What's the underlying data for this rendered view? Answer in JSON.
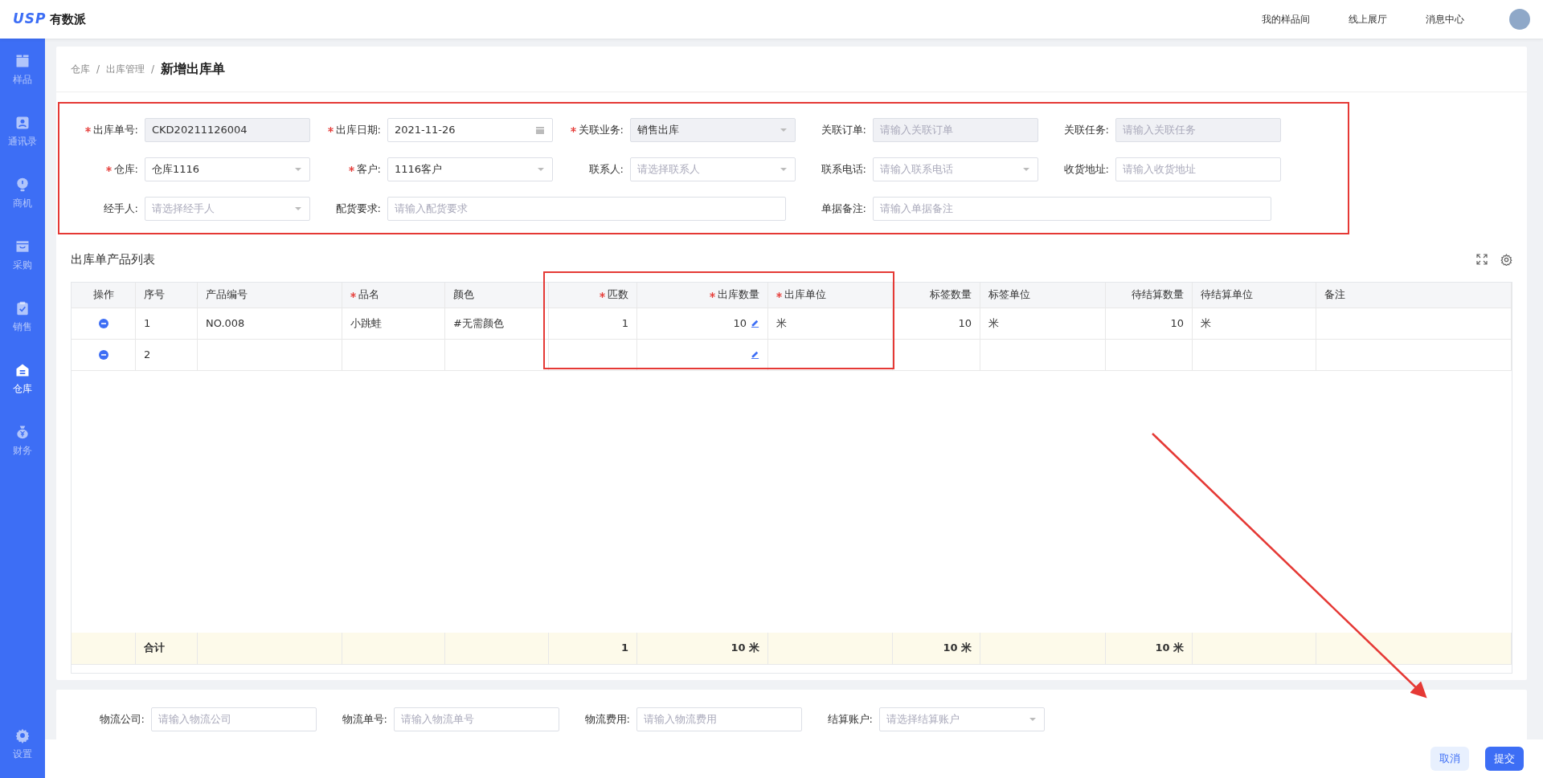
{
  "header": {
    "logo_mark": "USP",
    "logo_text": "有数派",
    "nav": [
      "我的样品间",
      "线上展厅",
      "消息中心"
    ]
  },
  "sidebar": {
    "items": [
      {
        "label": "样品",
        "selected": false
      },
      {
        "label": "通讯录",
        "selected": false
      },
      {
        "label": "商机",
        "selected": false
      },
      {
        "label": "采购",
        "selected": false
      },
      {
        "label": "销售",
        "selected": false
      },
      {
        "label": "仓库",
        "selected": true
      },
      {
        "label": "财务",
        "selected": false
      }
    ],
    "bottom_items": [
      {
        "label": "设置",
        "selected": false
      }
    ]
  },
  "breadcrumb": {
    "separator": "/",
    "items": [
      "仓库",
      "出库管理",
      "新增出库单"
    ]
  },
  "form": {
    "rows": [
      [
        {
          "label": "出库单号:",
          "required": true,
          "kind": "input",
          "value": "CKD20211126004",
          "disabled": true
        },
        {
          "label": "出库日期:",
          "required": true,
          "kind": "date",
          "value": "2021-11-26",
          "disabled": false
        },
        {
          "label": "关联业务:",
          "required": true,
          "kind": "select",
          "value": "销售出库",
          "disabled": true
        },
        {
          "label": "关联订单:",
          "required": false,
          "kind": "input",
          "placeholder": "请输入关联订单",
          "disabled": true
        },
        {
          "label": "关联任务:",
          "required": false,
          "kind": "input",
          "placeholder": "请输入关联任务",
          "disabled": true
        }
      ],
      [
        {
          "label": "仓库:",
          "required": true,
          "kind": "select",
          "value": "仓库1116",
          "disabled": false
        },
        {
          "label": "客户:",
          "required": true,
          "kind": "select",
          "value": "1116客户",
          "disabled": false
        },
        {
          "label": "联系人:",
          "required": false,
          "kind": "select",
          "placeholder": "请选择联系人",
          "disabled": false
        },
        {
          "label": "联系电话:",
          "required": false,
          "kind": "select",
          "placeholder": "请输入联系电话",
          "disabled": false
        },
        {
          "label": "收货地址:",
          "required": false,
          "kind": "input",
          "placeholder": "请输入收货地址",
          "disabled": false
        }
      ],
      [
        {
          "label": "经手人:",
          "required": false,
          "kind": "select",
          "placeholder": "请选择经手人",
          "disabled": false
        },
        {
          "label": "配货要求:",
          "required": false,
          "kind": "input",
          "placeholder": "请输入配货要求",
          "disabled": false
        },
        null,
        {
          "label": "单据备注:",
          "required": false,
          "kind": "input",
          "placeholder": "请输入单据备注",
          "disabled": false
        }
      ]
    ]
  },
  "table": {
    "title": "出库单产品列表",
    "columns": [
      {
        "label": "操作",
        "required": false,
        "kind": "action"
      },
      {
        "label": "序号",
        "required": false,
        "kind": "text"
      },
      {
        "label": "产品编号",
        "required": false,
        "kind": "text"
      },
      {
        "label": "品名",
        "required": true,
        "kind": "text"
      },
      {
        "label": "颜色",
        "required": false,
        "kind": "text"
      },
      {
        "label": "匹数",
        "required": true,
        "kind": "number"
      },
      {
        "label": "出库数量",
        "required": true,
        "kind": "edit"
      },
      {
        "label": "出库单位",
        "required": true,
        "kind": "text"
      },
      {
        "label": "标签数量",
        "required": false,
        "kind": "number"
      },
      {
        "label": "标签单位",
        "required": false,
        "kind": "text"
      },
      {
        "label": "待结算数量",
        "required": false,
        "kind": "number"
      },
      {
        "label": "待结算单位",
        "required": false,
        "kind": "text"
      },
      {
        "label": "备注",
        "required": false,
        "kind": "text"
      }
    ],
    "rows": [
      [
        null,
        "1",
        "NO.008",
        "小跳蛙",
        "#无需颜色",
        "1",
        "10",
        "米",
        "10",
        "米",
        "10",
        "米",
        null
      ],
      [
        null,
        "2",
        null,
        null,
        null,
        null,
        null,
        null,
        null,
        null,
        null,
        null,
        null
      ]
    ],
    "footer_rows": [
      [
        null,
        "合计",
        null,
        null,
        null,
        "1",
        "10 米",
        null,
        "10 米",
        null,
        "10 米",
        null,
        null
      ]
    ]
  },
  "logistics": [
    {
      "label": "物流公司:",
      "kind": "input",
      "placeholder": "请输入物流公司"
    },
    {
      "label": "物流单号:",
      "kind": "input",
      "placeholder": "请输入物流单号"
    },
    {
      "label": "物流费用:",
      "kind": "input",
      "placeholder": "请输入物流费用"
    },
    {
      "label": "结算账户:",
      "kind": "select",
      "placeholder": "请选择结算账户"
    }
  ],
  "actions": [
    {
      "label": "取消",
      "kind": "secondary"
    },
    {
      "label": "提交",
      "kind": "primary"
    }
  ]
}
